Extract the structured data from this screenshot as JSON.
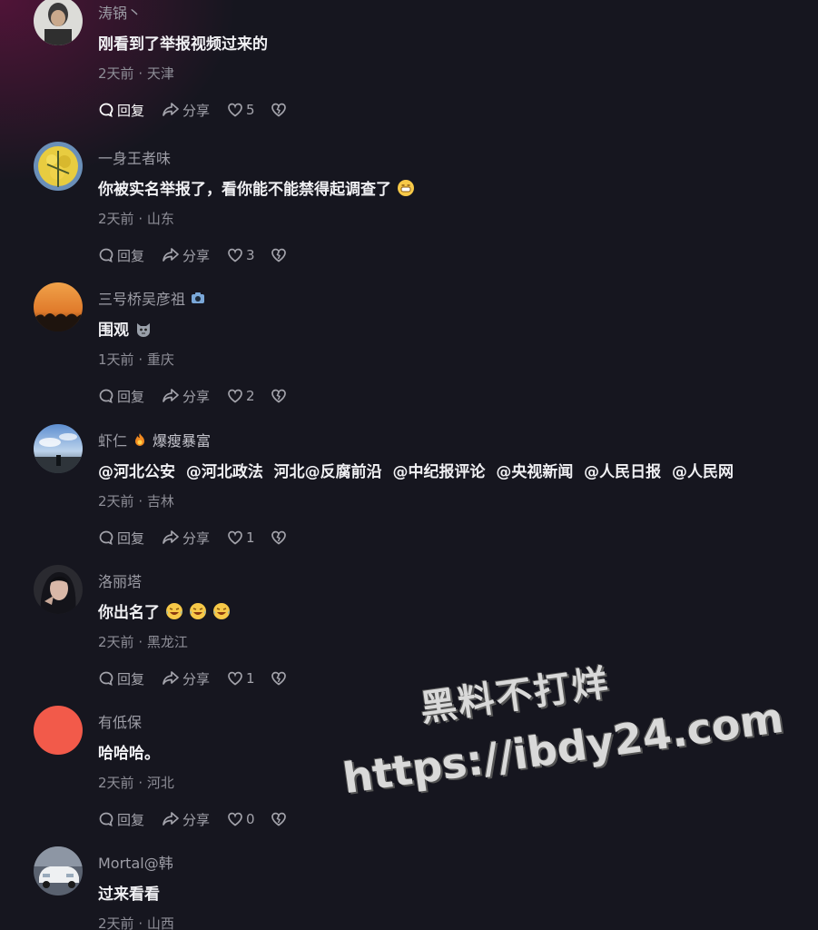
{
  "labels": {
    "reply": "回复",
    "share": "分享",
    "separator": "·"
  },
  "comments": [
    {
      "username": "涛锅丶",
      "content": "刚看到了举报视频过来的",
      "time": "2天前",
      "location": "天津",
      "likes": "5"
    },
    {
      "username": "一身王者味",
      "content": "你被实名举报了，看你能不能禁得起调查了",
      "time": "2天前",
      "location": "山东",
      "likes": "3"
    },
    {
      "username": "三号桥吴彦祖",
      "content": "围观",
      "time": "1天前",
      "location": "重庆",
      "likes": "2"
    },
    {
      "username": "虾仁",
      "tag": "爆瘦暴富",
      "content": "@河北公安  @河北政法  河北@反腐前沿  @中纪报评论  @央视新闻  @人民日报  @人民网",
      "time": "2天前",
      "location": "吉林",
      "likes": "1"
    },
    {
      "username": "洛丽塔",
      "content": "你出名了",
      "time": "2天前",
      "location": "黑龙江",
      "likes": "1"
    },
    {
      "username": "有低保",
      "content": "哈哈哈。",
      "time": "2天前",
      "location": "河北",
      "likes": "0"
    },
    {
      "username": "Mortal@韩",
      "content": "过来看看",
      "time": "2天前",
      "location": "山西"
    }
  ],
  "watermark": {
    "line1": "黑料不打烊",
    "line2": "https://ibdy24.com"
  },
  "colors": {
    "background": "#16161f",
    "username": "#9d9da6",
    "content": "#f0f0f3",
    "meta": "#8e8e97",
    "red_avatar": "#f25a4a"
  }
}
